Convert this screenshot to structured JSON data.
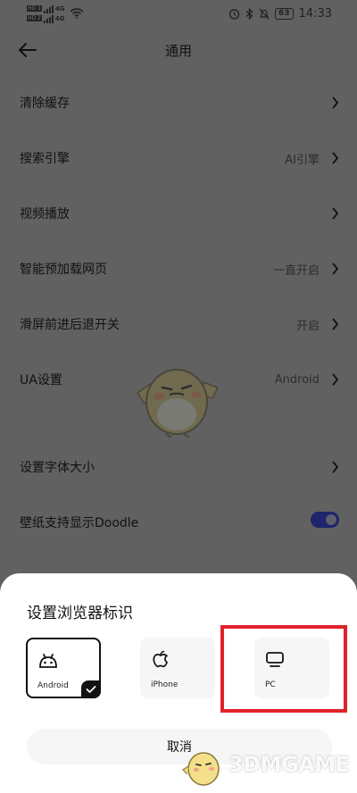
{
  "status_bar": {
    "sim1": "HD 1",
    "sim2": "HD 2",
    "net1": "4G",
    "net2": "4G",
    "battery": "63",
    "time": "14:33",
    "icons": [
      "wifi-icon",
      "alarm-icon",
      "bluetooth-icon",
      "mute-icon"
    ]
  },
  "header": {
    "title": "通用",
    "back_icon": "arrow-left-icon"
  },
  "settings": [
    {
      "label": "清除缓存",
      "value": ""
    },
    {
      "label": "搜索引擎",
      "value": "AI引擎"
    },
    {
      "label": "视频播放",
      "value": ""
    },
    {
      "label": "智能预加载网页",
      "value": "一直开启"
    },
    {
      "label": "滑屏前进后退开关",
      "value": "开启"
    },
    {
      "label": "UA设置",
      "value": "Android"
    },
    {
      "label": "设置字体大小",
      "value": ""
    },
    {
      "label": "壁纸支持显示Doodle",
      "value": "",
      "toggle": true
    }
  ],
  "sheet": {
    "title": "设置浏览器标识",
    "options": [
      {
        "label": "Android",
        "icon": "android-icon",
        "selected": true
      },
      {
        "label": "iPhone",
        "icon": "apple-icon",
        "selected": false
      },
      {
        "label": "PC",
        "icon": "monitor-icon",
        "selected": false
      }
    ],
    "cancel": "取消"
  },
  "watermark": {
    "text": "3DMGAME"
  },
  "colors": {
    "dim_overlay": "#616161",
    "toggle_on": "#1d256b",
    "highlight": "#e0232b",
    "sheet_bg": "#ffffff"
  }
}
